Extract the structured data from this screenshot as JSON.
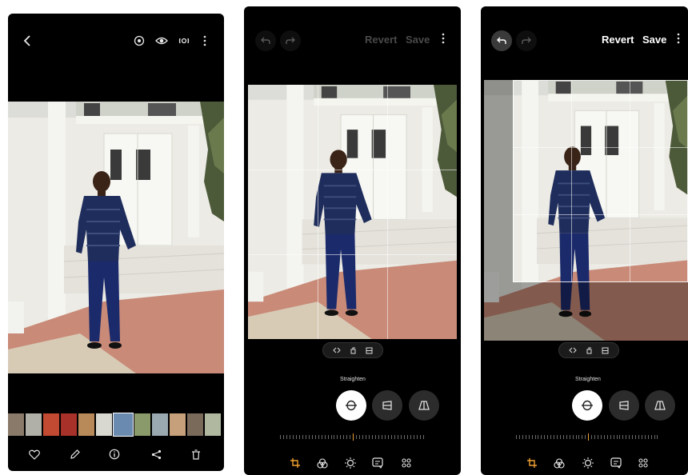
{
  "screen1": {
    "top_icons": [
      "back-arrow-icon",
      "motion-photo-icon",
      "eye-icon",
      "live-focus-icon",
      "more-vertical-icon"
    ],
    "bottom_actions": [
      "favorite-heart-icon",
      "edit-pencil-icon",
      "info-icon",
      "share-icon",
      "delete-trash-icon"
    ],
    "thumbnail_count": 12,
    "selected_thumbnail_index": 6
  },
  "screen2": {
    "revert_label": "Revert",
    "save_label": "Save",
    "buttons_enabled": false,
    "mode_label": "Straighten",
    "modes": [
      "straighten-icon",
      "vertical-perspective-icon",
      "horizontal-perspective-icon"
    ],
    "active_mode_index": 0,
    "pill_icons": [
      "flip-icon",
      "rotate-icon",
      "aspect-ratio-icon"
    ],
    "bottom_tools": [
      "transform-icon",
      "filters-icon",
      "tone-icon",
      "decorations-icon",
      "more-tools-icon"
    ],
    "active_tool_index": 0
  },
  "screen3": {
    "revert_label": "Revert",
    "save_label": "Save",
    "buttons_enabled": true,
    "mode_label": "Straighten",
    "modes": [
      "straighten-icon",
      "vertical-perspective-icon",
      "horizontal-perspective-icon"
    ],
    "active_mode_index": 0,
    "pill_icons": [
      "flip-icon",
      "rotate-icon",
      "aspect-ratio-icon"
    ],
    "bottom_tools": [
      "transform-icon",
      "filters-icon",
      "tone-icon",
      "decorations-icon",
      "more-tools-icon"
    ],
    "active_tool_index": 0
  },
  "colors": {
    "accent": "#f0a030",
    "wall": "#e9e8e2",
    "shirt": "#1f2d5c",
    "pants": "#1b2a6b",
    "bricks": "#c98a78"
  }
}
